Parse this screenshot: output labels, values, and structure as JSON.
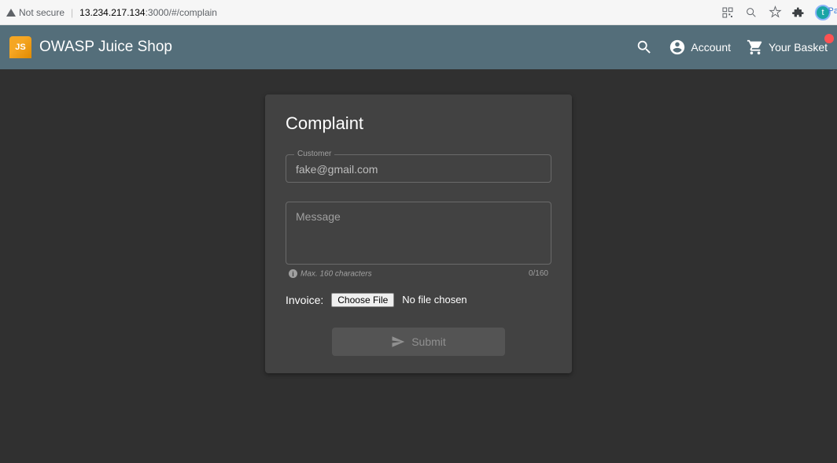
{
  "browser": {
    "security_label": "Not secure",
    "url_ip": "13.234.217.134",
    "url_path": ":3000/#/complain",
    "avatar_letter": "t",
    "pa_label": "Pa"
  },
  "header": {
    "brand_logo_text": "JS",
    "brand_title": "OWASP Juice Shop",
    "account_label": "Account",
    "basket_label": "Your Basket"
  },
  "card": {
    "title": "Complaint",
    "customer": {
      "label": "Customer",
      "value": "fake@gmail.com"
    },
    "message": {
      "placeholder": "Message",
      "hint": "Max. 160 characters",
      "counter": "0/160"
    },
    "invoice": {
      "label": "Invoice:",
      "button": "Choose File",
      "status": "No file chosen"
    },
    "submit_label": "Submit"
  }
}
